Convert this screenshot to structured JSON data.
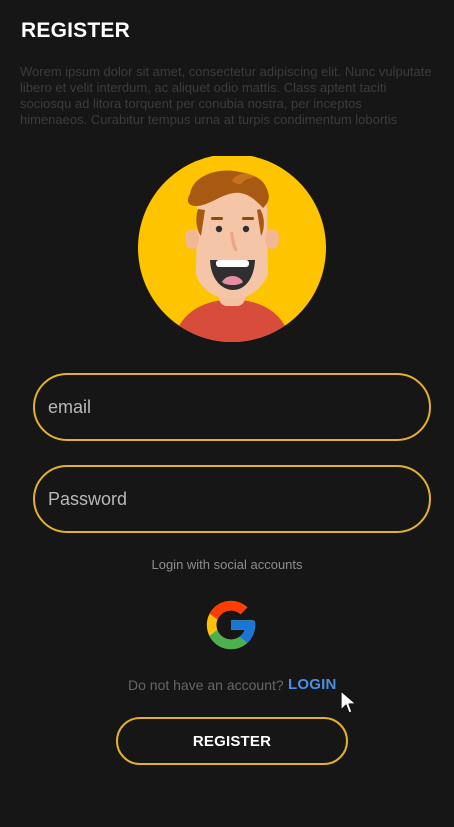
{
  "page": {
    "title": "REGISTER",
    "description": "Worem ipsum dolor sit amet, consectetur adipiscing elit. Nunc vulputate libero et velit interdum, ac aliquet odio mattis. Class aptent taciti sociosqu ad litora torquent per conubia nostra, per inceptos himenaeos. Curabitur tempus urna at turpis condimentum lobortis"
  },
  "form": {
    "email": {
      "value": "",
      "placeholder": "email"
    },
    "password": {
      "value": "",
      "placeholder": "Password"
    }
  },
  "social": {
    "label": "Login with social accounts",
    "icon": "google-icon"
  },
  "account": {
    "question": "Do not have an account?",
    "login_label": "LOGIN"
  },
  "actions": {
    "register_label": "REGISTER"
  },
  "colors": {
    "background": "#161616",
    "accent": "#e3b12d",
    "link": "#4b8ee7"
  }
}
